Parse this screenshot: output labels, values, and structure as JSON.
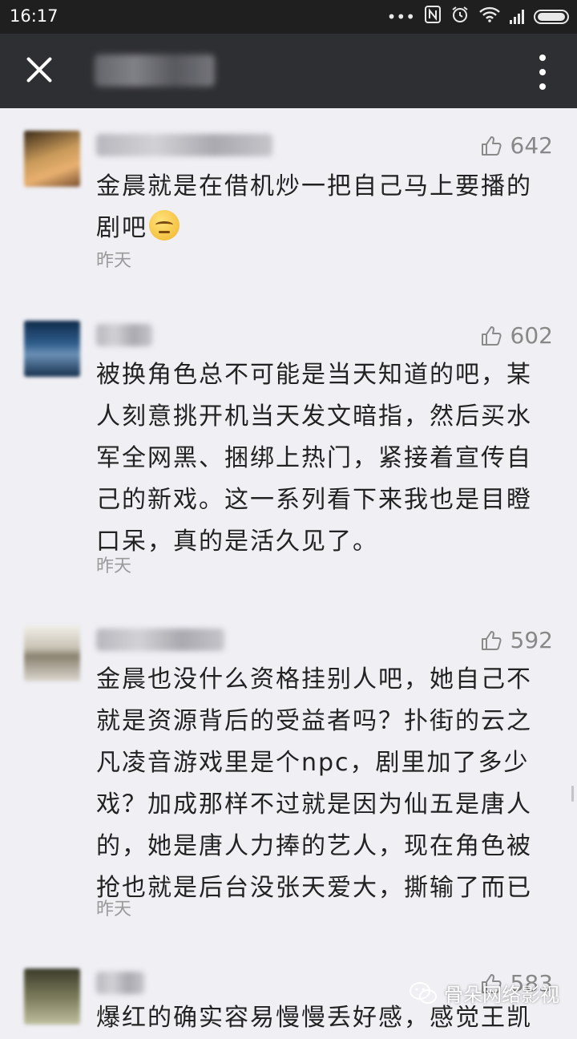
{
  "status_bar": {
    "time": "16:17",
    "dots": "•••"
  },
  "comments": [
    {
      "likes": "642",
      "text": "金晨就是在借机炒一把自己马上要播的剧吧",
      "time": "昨天"
    },
    {
      "likes": "602",
      "text": "被换角色总不可能是当天知道的吧，某人刻意挑开机当天发文暗指，然后买水军全网黑、捆绑上热门，紧接着宣传自己的新戏。这一系列看下来我也是目瞪口呆，真的是活久见了。",
      "time": "昨天"
    },
    {
      "likes": "592",
      "text": "金晨也没什么资格挂别人吧，她自己不就是资源背后的受益者吗？扑街的云之凡凌音游戏里是个npc，剧里加了多少戏？加成那样不过就是因为仙五是唐人的，她是唐人力捧的艺人，现在角色被抢也就是后台没张天爱大，撕输了而已",
      "time": "昨天"
    },
    {
      "likes": "583",
      "text": "爆红的确实容易慢慢丢好感，感觉王凯",
      "time": ""
    }
  ],
  "watermark": {
    "text": "骨朵网络影视"
  },
  "colors": {
    "header_bg": "#2e2f33",
    "status_bg": "#1f1f1f",
    "page_bg": "#efeff4"
  }
}
